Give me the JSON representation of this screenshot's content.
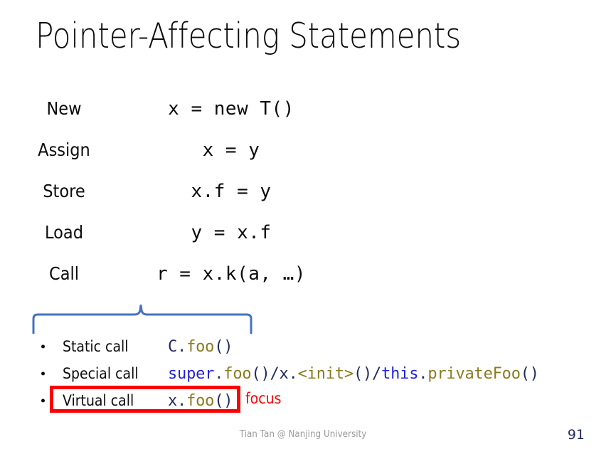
{
  "slide": {
    "title": "Pointer-Affecting Statements",
    "page_number": "91",
    "footer": "Tian Tan @ Nanjing University",
    "colors": {
      "brace": "#4472c4",
      "highlight": "#ff0000",
      "keyword": "#2323dc",
      "method": "#8a7b22",
      "punctuation": "#1f2b5e",
      "footer_text": "#9a9a9a"
    }
  },
  "statements": [
    {
      "label": "New",
      "code": "x = new T()"
    },
    {
      "label": "Assign",
      "code": "x = y"
    },
    {
      "label": "Store",
      "code": "x.f = y"
    },
    {
      "label": "Load",
      "code": "y = x.f"
    },
    {
      "label": "Call",
      "code": "r = x.k(a, …)"
    }
  ],
  "call_kinds": [
    {
      "label": "Static call",
      "code_tokens": [
        {
          "text": "C",
          "kind": "pun"
        },
        {
          "text": ".",
          "kind": "pun"
        },
        {
          "text": "foo",
          "kind": "mth"
        },
        {
          "text": "()",
          "kind": "pun"
        }
      ]
    },
    {
      "label": "Special call",
      "code_tokens": [
        {
          "text": "super",
          "kind": "kw"
        },
        {
          "text": ".",
          "kind": "pun"
        },
        {
          "text": "foo",
          "kind": "mth"
        },
        {
          "text": "()/x.",
          "kind": "pun"
        },
        {
          "text": "<init>",
          "kind": "mth"
        },
        {
          "text": "()/",
          "kind": "pun"
        },
        {
          "text": "this",
          "kind": "kw"
        },
        {
          "text": ".",
          "kind": "pun"
        },
        {
          "text": "privateFoo",
          "kind": "mth"
        },
        {
          "text": "()",
          "kind": "pun"
        }
      ]
    },
    {
      "label": "Virtual call",
      "code_tokens": [
        {
          "text": "x",
          "kind": "pun"
        },
        {
          "text": ".",
          "kind": "pun"
        },
        {
          "text": "foo",
          "kind": "mth"
        },
        {
          "text": "()",
          "kind": "pun"
        }
      ]
    }
  ],
  "focus": {
    "note": "focus",
    "highlighted_kind": "Virtual call"
  }
}
